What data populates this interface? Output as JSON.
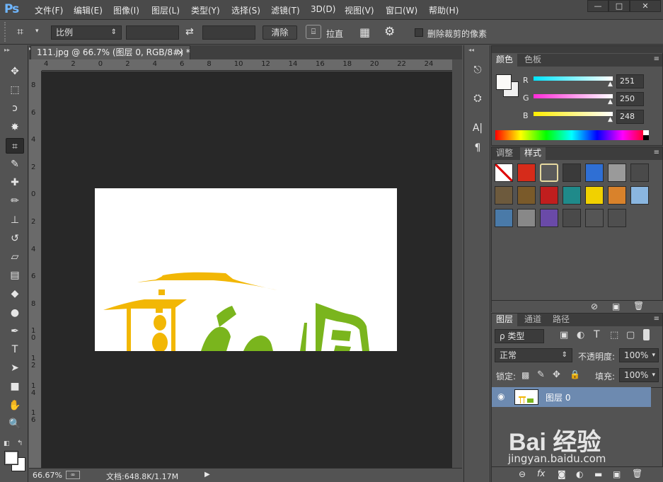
{
  "app": {
    "logo": "Ps"
  },
  "menu": [
    "文件(F)",
    "编辑(E)",
    "图像(I)",
    "图层(L)",
    "类型(Y)",
    "选择(S)",
    "滤镜(T)",
    "3D(D)",
    "视图(V)",
    "窗口(W)",
    "帮助(H)"
  ],
  "window_controls": {
    "minimize": "—",
    "maximize": "□",
    "close": "✕"
  },
  "options": {
    "ratio_select": "比例",
    "clear_button": "清除",
    "straighten_label": "拉直",
    "delete_cropped_label": "删除裁剪的像素",
    "swap_icon": "⇄"
  },
  "tools": [
    {
      "name": "move-tool",
      "glyph": "✥"
    },
    {
      "name": "marquee-tool",
      "glyph": "⬚"
    },
    {
      "name": "lasso-tool",
      "glyph": "ↄ"
    },
    {
      "name": "magic-wand-tool",
      "glyph": "✸"
    },
    {
      "name": "crop-tool",
      "glyph": "⌗"
    },
    {
      "name": "eyedropper-tool",
      "glyph": "✎"
    },
    {
      "name": "healing-brush-tool",
      "glyph": "✚"
    },
    {
      "name": "brush-tool",
      "glyph": "✏"
    },
    {
      "name": "clone-stamp-tool",
      "glyph": "⊥"
    },
    {
      "name": "history-brush-tool",
      "glyph": "↺"
    },
    {
      "name": "eraser-tool",
      "glyph": "▱"
    },
    {
      "name": "gradient-tool",
      "glyph": "▤"
    },
    {
      "name": "blur-tool",
      "glyph": "◆"
    },
    {
      "name": "dodge-tool",
      "glyph": "●"
    },
    {
      "name": "pen-tool",
      "glyph": "✒"
    },
    {
      "name": "type-tool",
      "glyph": "T"
    },
    {
      "name": "path-selection-tool",
      "glyph": "➤"
    },
    {
      "name": "rectangle-tool",
      "glyph": "■"
    },
    {
      "name": "hand-tool",
      "glyph": "✋"
    },
    {
      "name": "zoom-tool",
      "glyph": "🔍"
    }
  ],
  "document": {
    "tab_title": "111.jpg @ 66.7% (图层 0, RGB/8#) *",
    "tab_close": "×",
    "hruler_ticks": [
      "4",
      "2",
      "0",
      "2",
      "4",
      "6",
      "8",
      "10",
      "12",
      "14",
      "16",
      "18",
      "20",
      "22",
      "24"
    ],
    "vruler_ticks": [
      "8",
      "6",
      "4",
      "2",
      "0",
      "2",
      "4",
      "6",
      "8",
      "1 0",
      "1 2",
      "1 4",
      "1 6"
    ]
  },
  "status": {
    "zoom": "66.67%",
    "doc_info": "文档:648.8K/1.17M",
    "arrow": "▶"
  },
  "color_panel": {
    "tabs": [
      "颜色",
      "色板"
    ],
    "channels": [
      {
        "label": "R",
        "value": "251",
        "color": "#00e5ff"
      },
      {
        "label": "G",
        "value": "250",
        "color": "#ff2bd8"
      },
      {
        "label": "B",
        "value": "248",
        "color": "#ffee00"
      }
    ]
  },
  "styles_panel": {
    "tabs": [
      "调整",
      "样式"
    ],
    "swatches": [
      "#ffffff",
      "#d62b1a",
      "#5a5a5a",
      "#3a3a3a",
      "#2f6fd4",
      "#9a9a9a",
      "#4a4a4a",
      "#6d5a3d",
      "#7a5a2a",
      "#c01e1e",
      "#1f8a8a",
      "#f1d100",
      "#d9822b",
      "#8ab6e0",
      "#4a7aa8",
      "#888888",
      "#6a4aa8",
      "#4a4a4a",
      "#555555",
      "#4f4f4f"
    ],
    "footer_icons": [
      "⊘",
      "▣",
      "🗑"
    ]
  },
  "layers_panel": {
    "tabs": [
      "图层",
      "通道",
      "路径"
    ],
    "filter_label": "ρ 类型",
    "blend_mode": "正常",
    "opacity_label": "不透明度:",
    "opacity_value": "100%",
    "lock_label": "锁定:",
    "fill_label": "填充:",
    "fill_value": "100%",
    "layer_name": "图层 0",
    "footer_icons": [
      "⊖",
      "fx",
      "◙",
      "◐",
      "▬",
      "▣",
      "🗑"
    ]
  },
  "watermark": {
    "brand": "Bai 经验",
    "url": "jingyan.baidu.com"
  },
  "colors": {
    "accent": "#6fb6ff",
    "layer_selected": "#6d8ab0",
    "canvas_bg": "#282828",
    "logo_yellow": "#f2b705",
    "logo_green": "#7ab51d"
  }
}
